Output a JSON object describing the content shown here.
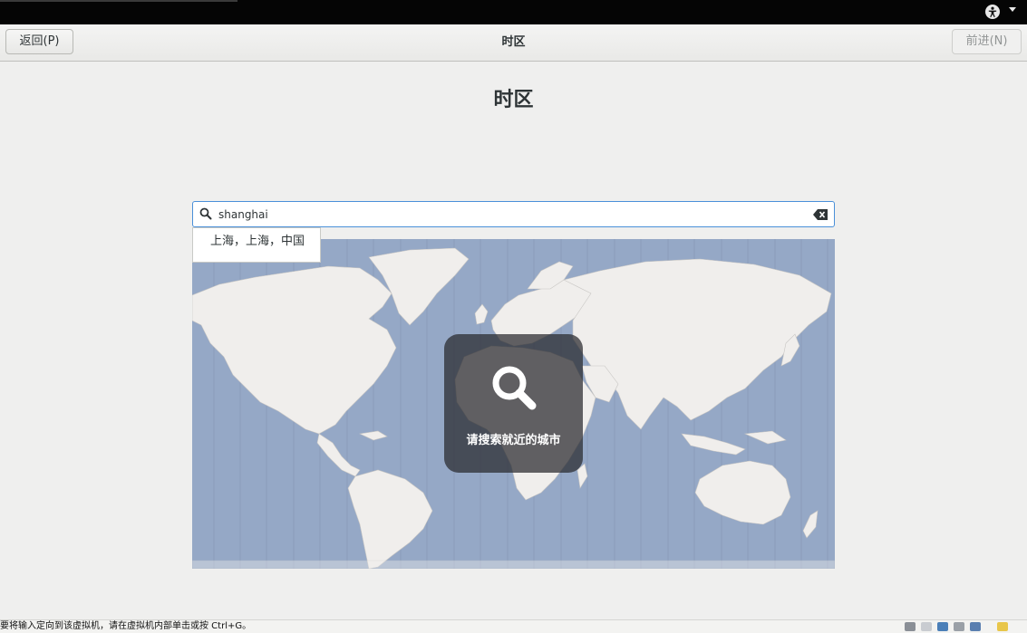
{
  "window": {
    "title": "时区"
  },
  "header": {
    "back_label": "返回(P)",
    "next_label": "前进(N)",
    "title": "时区"
  },
  "page": {
    "heading": "时区"
  },
  "search": {
    "value": "shanghai"
  },
  "suggestions": [
    "上海，上海，中国"
  ],
  "overlay": {
    "text": "请搜索就近的城市"
  },
  "statusbar": {
    "text": "要将输入定向到该虚拟机，请在虚拟机内部单击或按 Ctrl+G。"
  },
  "colors": {
    "ocean": "#95a8c6",
    "land": "#f0eeec",
    "search_border": "#4a90d9",
    "overlay_bg": "#28282c"
  },
  "icons": {
    "accessibility": "accessibility-icon",
    "search": "search-icon",
    "clear": "clear-icon",
    "overlay": "magnifier-icon"
  }
}
